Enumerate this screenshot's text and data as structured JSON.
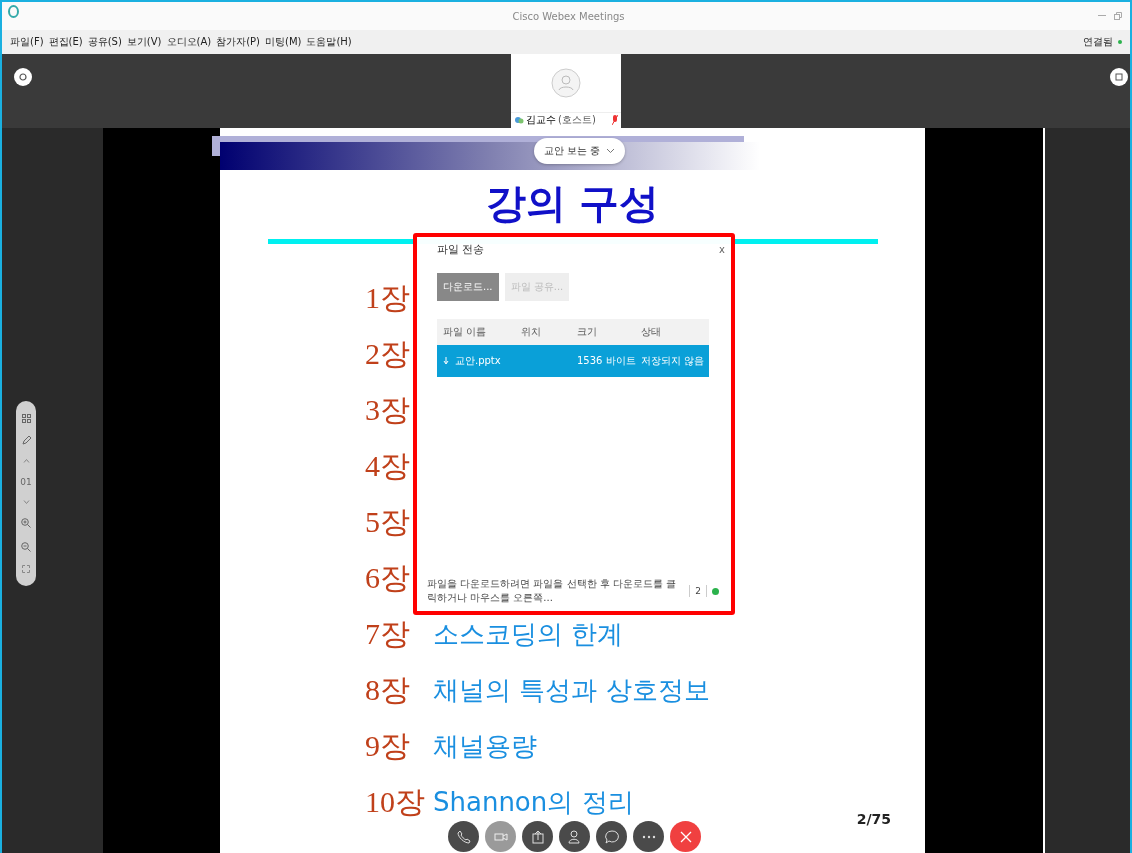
{
  "window": {
    "title": "Cisco Webex Meetings"
  },
  "menu": [
    "파일(F)",
    "편집(E)",
    "공유(S)",
    "보기(V)",
    "오디오(A)",
    "참가자(P)",
    "미팅(M)",
    "도움말(H)"
  ],
  "connection": {
    "label": "연결됨",
    "color": "#2bb24c"
  },
  "participant": {
    "name": "김교수",
    "role": "(호스트)",
    "muted": true
  },
  "viewing_pill": {
    "label": "교안 보는 중"
  },
  "slide": {
    "title": "강의 구성",
    "page": "2/75",
    "chapters": [
      {
        "number": "1장"
      },
      {
        "number": "2장"
      },
      {
        "number": "3장"
      },
      {
        "number": "4장"
      },
      {
        "number": "5장"
      },
      {
        "number": "6장"
      },
      {
        "number": "7장",
        "title": "소스코딩의 한계"
      },
      {
        "number": "8장",
        "title": "채널의 특성과 상호정보"
      },
      {
        "number": "9장",
        "title": "채널용량"
      },
      {
        "number": "10장",
        "title": "Shannon의 정리"
      }
    ]
  },
  "zoom_panel": {
    "page": "01"
  },
  "dialog": {
    "title": "파일 전송",
    "close": "x",
    "buttons": [
      {
        "label": "다운로드...",
        "disabled": false
      },
      {
        "label": "파일 공유...",
        "disabled": true
      }
    ],
    "columns": [
      "파일 이름",
      "위치",
      "크기",
      "상태"
    ],
    "rows": [
      {
        "name": "교안.pptx",
        "size": "1536 바이트",
        "status": "저장되지 않음",
        "selected": true
      }
    ],
    "hint": "파일을 다운로드하려면 파일을 선택한 후 다운로드를 클릭하거나 마우스를 오른쪽...",
    "count": "2",
    "status_dot": {
      "color": "#2bb24c"
    }
  },
  "controls": [
    {
      "kind": "phone",
      "disabled": false
    },
    {
      "kind": "video",
      "disabled": true
    },
    {
      "kind": "share",
      "disabled": false
    },
    {
      "kind": "participants",
      "disabled": false
    },
    {
      "kind": "chat",
      "disabled": false
    },
    {
      "kind": "more",
      "disabled": false
    },
    {
      "kind": "end",
      "disabled": false
    }
  ]
}
